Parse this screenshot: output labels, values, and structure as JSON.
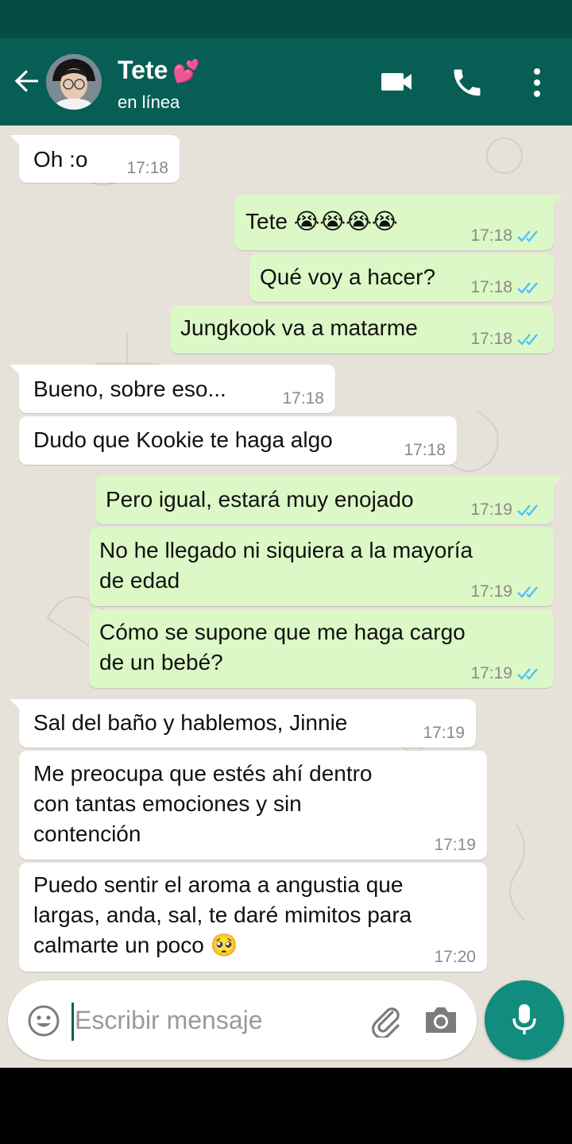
{
  "header": {
    "contact_name": "Tete",
    "name_emoji": "💕",
    "status": "en línea"
  },
  "colors": {
    "header": "#075e54",
    "status_bar": "#054d44",
    "outgoing_bubble": "#dcf8c6",
    "incoming_bubble": "#ffffff",
    "read_ticks": "#4fc3f7",
    "mic_button": "#128c7e"
  },
  "icons": {
    "back": "arrow-left-icon",
    "video": "video-camera-icon",
    "call": "phone-icon",
    "menu": "more-vert-icon",
    "emoji": "smiley-icon",
    "attach": "paperclip-icon",
    "camera": "camera-icon",
    "mic": "microphone-icon"
  },
  "messages": [
    {
      "direction": "in",
      "text": "Oh :o",
      "time": "17:18"
    },
    {
      "direction": "out",
      "text": "Tete 😭😭😭😭",
      "time": "17:18",
      "status": "read"
    },
    {
      "direction": "out",
      "text": "Qué voy a hacer?",
      "time": "17:18",
      "status": "read"
    },
    {
      "direction": "out",
      "text": "Jungkook va a matarme",
      "time": "17:18",
      "status": "read"
    },
    {
      "direction": "in",
      "text": "Bueno, sobre eso...",
      "time": "17:18"
    },
    {
      "direction": "in",
      "text": "Dudo que Kookie te haga algo",
      "time": "17:18"
    },
    {
      "direction": "out",
      "text": "Pero igual, estará muy enojado",
      "time": "17:19",
      "status": "read"
    },
    {
      "direction": "out",
      "text": "No he llegado ni siquiera a la mayoría\nde edad",
      "time": "17:19",
      "status": "read"
    },
    {
      "direction": "out",
      "text": "Cómo se supone que me haga cargo\nde un bebé?",
      "time": "17:19",
      "status": "read"
    },
    {
      "direction": "in",
      "text": "Sal del baño y hablemos, Jinnie",
      "time": "17:19"
    },
    {
      "direction": "in",
      "text": "Me preocupa que estés ahí dentro\ncon tantas emociones y sin\ncontención",
      "time": "17:19"
    },
    {
      "direction": "in",
      "text": "Puedo sentir el aroma a angustia que\nlargas, anda, sal, te daré mimitos para\ncalmarte un poco 🥺",
      "time": "17:20"
    }
  ],
  "composer": {
    "placeholder": "Escribir mensaje"
  }
}
